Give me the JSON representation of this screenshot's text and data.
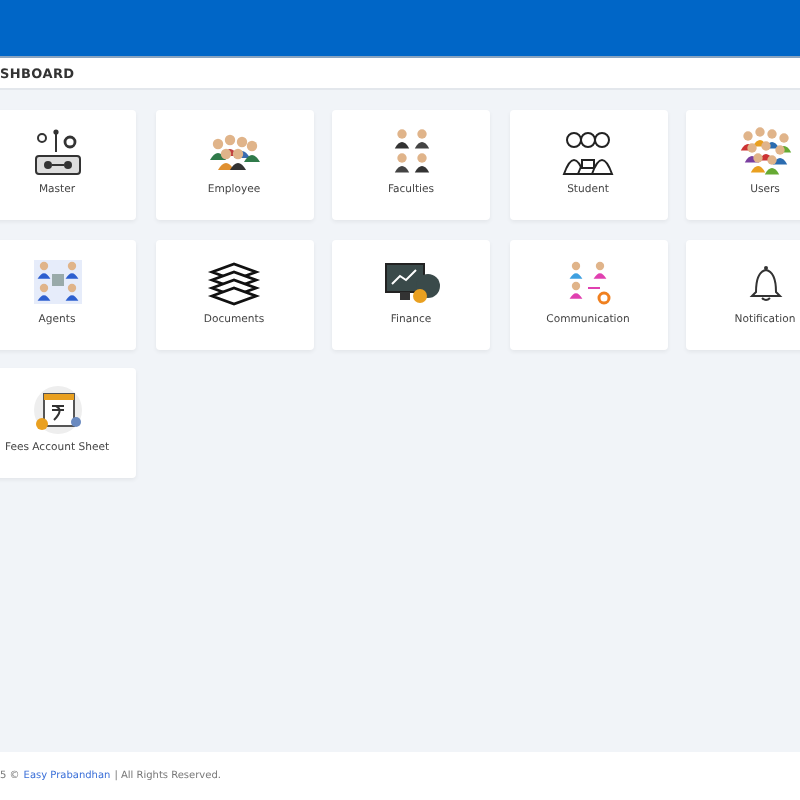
{
  "breadcrumb": "SHBOARD",
  "tiles": [
    {
      "kind": "master",
      "label": "Master"
    },
    {
      "kind": "employee",
      "label": "Employee"
    },
    {
      "kind": "faculties",
      "label": "Faculties"
    },
    {
      "kind": "student",
      "label": "Student"
    },
    {
      "kind": "users",
      "label": "Users"
    },
    {
      "kind": "agents",
      "label": "Agents"
    },
    {
      "kind": "documents",
      "label": "Documents"
    },
    {
      "kind": "finance",
      "label": "Finance"
    },
    {
      "kind": "communication",
      "label": "Communication"
    },
    {
      "kind": "notification",
      "label": "Notification"
    },
    {
      "kind": "fees",
      "label": "Fees Account Sheet"
    }
  ],
  "footer": {
    "prefix": "5 ©",
    "link": "Easy Prabandhan",
    "suffix": "| All Rights Reserved."
  }
}
